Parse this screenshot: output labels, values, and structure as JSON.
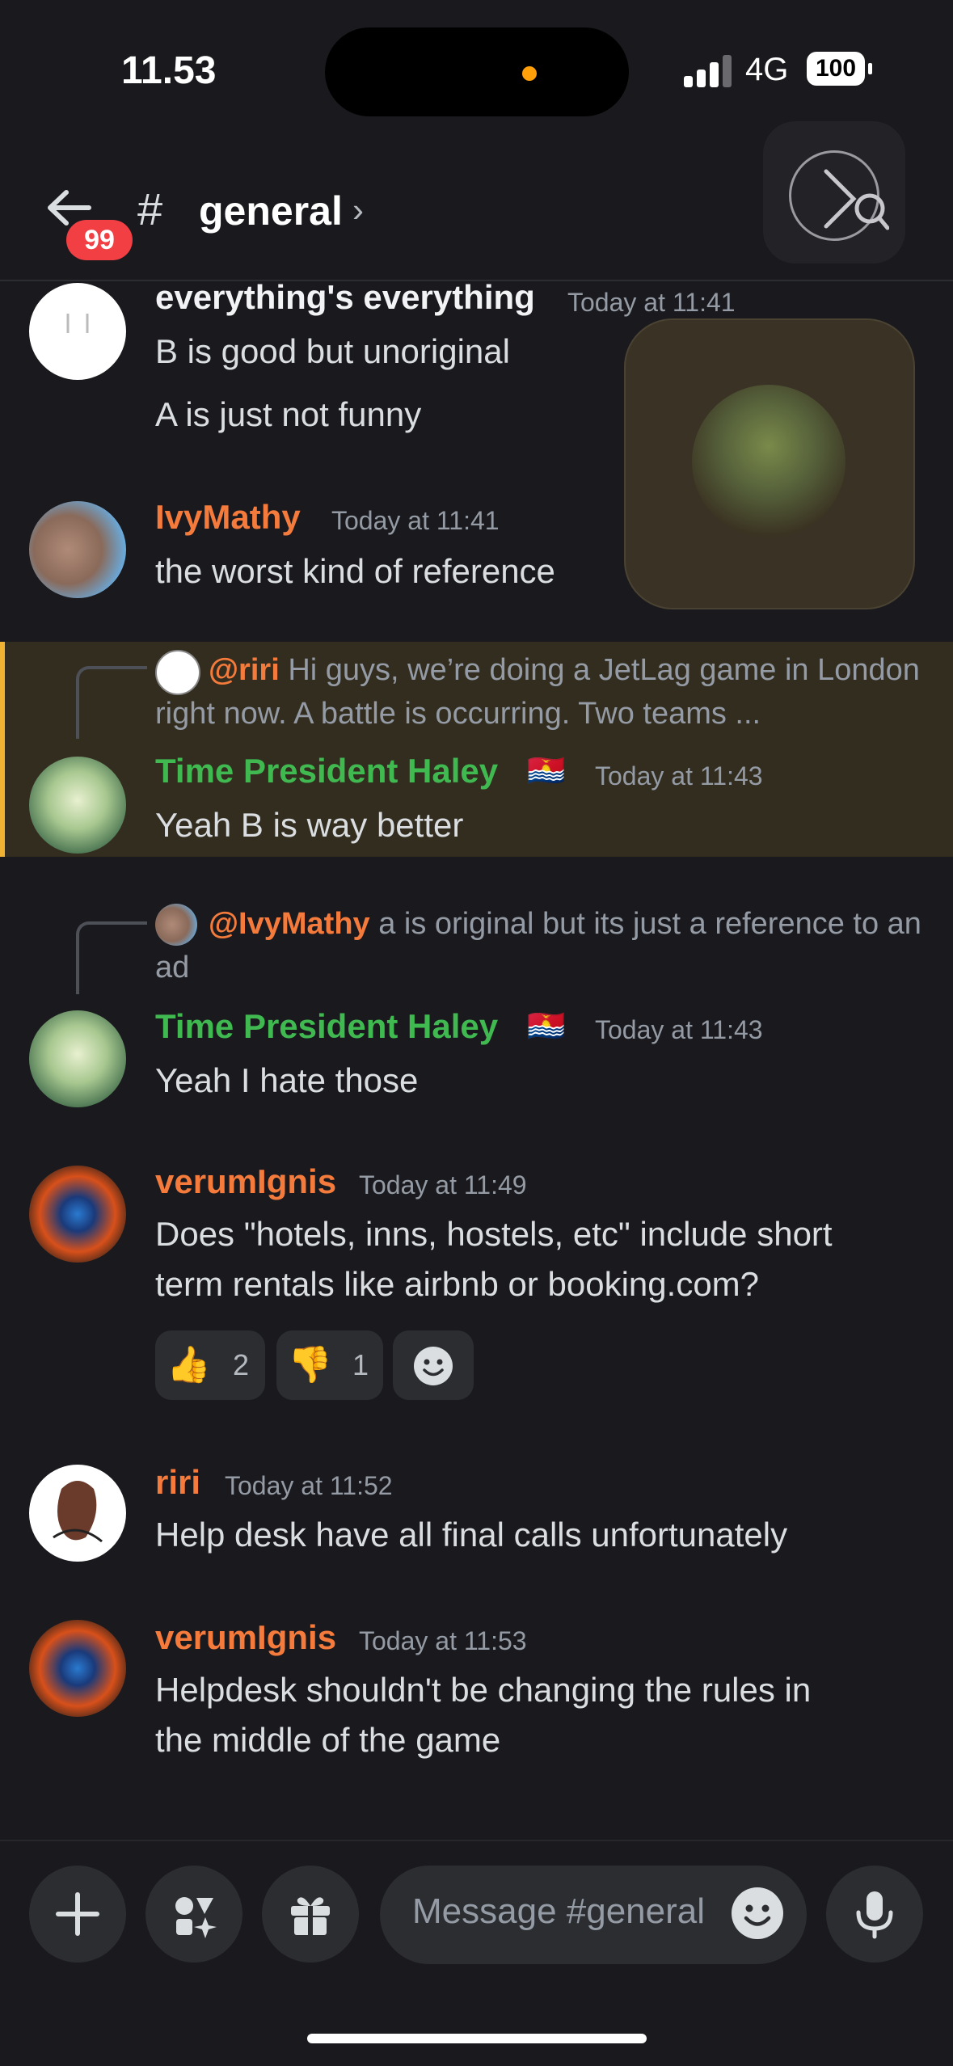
{
  "status_bar": {
    "time": "11.53",
    "network": "4G",
    "battery": "100"
  },
  "header": {
    "unread_badge": "99",
    "hash": "#",
    "channel_name": "general",
    "chevron": "›"
  },
  "messages": [
    {
      "author": "everything's everything",
      "timestamp": "Today at 11:41",
      "lines": [
        "B is good but unoriginal",
        "A is just not funny"
      ]
    },
    {
      "author": "IvyMathy",
      "timestamp": "Today at 11:41",
      "lines": [
        "the worst kind of reference"
      ]
    },
    {
      "reply": {
        "name": "@riri",
        "text": "Hi guys, we’re doing a JetLag game in London right now. A battle is occurring. Two teams ..."
      },
      "author": "Time President Haley",
      "flag": "🇰🇮",
      "timestamp": "Today at 11:43",
      "lines": [
        "Yeah B is way better"
      ]
    },
    {
      "reply": {
        "name": "@IvyMathy",
        "text": "a is original but its just a reference to an ad"
      },
      "author": "Time President Haley",
      "flag": "🇰🇮",
      "timestamp": "Today at 11:43",
      "lines": [
        "Yeah I hate those"
      ]
    },
    {
      "author": "verumIgnis",
      "timestamp": "Today at 11:49",
      "lines": [
        "Does \"hotels, inns, hostels, etc\" include short",
        "term rentals like airbnb or booking.com?"
      ],
      "reactions": [
        {
          "emoji": "👍",
          "count": "2"
        },
        {
          "emoji": "👎",
          "count": "1"
        }
      ]
    },
    {
      "author": "riri",
      "timestamp": "Today at 11:52",
      "lines": [
        "Help desk have all final calls unfortunately"
      ]
    },
    {
      "author": "verumIgnis",
      "timestamp": "Today at 11:53",
      "lines": [
        "Helpdesk shouldn't be changing the rules in",
        "the middle of the game"
      ]
    }
  ],
  "composer": {
    "placeholder": "Message #general"
  },
  "colors": {
    "orange_role": "#f47b3b",
    "green_role": "#3fb950",
    "highlight": "#332d20",
    "highlight_bar": "#f0b232"
  }
}
